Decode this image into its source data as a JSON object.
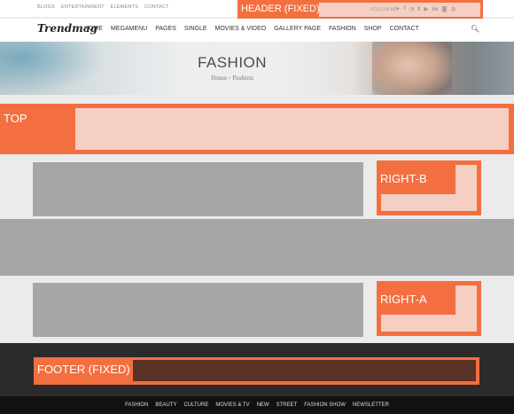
{
  "topbar": {
    "links": [
      "BLOGS",
      "ENTERTAINMENT",
      "ELEMENTS",
      "CONTACT"
    ],
    "header_label": "HEADER (FIXED)",
    "follow_label": "FOLLOW ME:",
    "social_icons": [
      "twitter-icon",
      "facebook-icon",
      "rss-icon",
      "tumblr-icon",
      "youtube-icon",
      "linkedin-icon",
      "instagram-icon",
      "dribbble-icon"
    ]
  },
  "nav": {
    "logo": "Trendmag",
    "items": [
      "HOME",
      "MEGAMENU",
      "PAGES",
      "SINGLE",
      "MOVIES & VIDEO",
      "GALLERY PAGE",
      "FASHION",
      "SHOP",
      "CONTACT"
    ],
    "search_icon": "search-icon"
  },
  "banner": {
    "title": "FASHION",
    "breadcrumb": "Home  ›  Fashion"
  },
  "sections": {
    "top_label": "TOP",
    "right_b_label": "RIGHT-B",
    "right_a_label": "RIGHT-A",
    "footer_label": "FOOTER (FIXED)"
  },
  "bottom": {
    "links": [
      "FASHION",
      "BEAUTY",
      "CULTURE",
      "MOVIES & TV",
      "NEW",
      "STREET",
      "FASHION SHOW",
      "NEWSLETTER"
    ]
  },
  "colors": {
    "accent": "#f36f40",
    "placeholder_pink": "#f4cfc2",
    "placeholder_gray": "#a6a6a6",
    "footer_dark": "#2b2b2b"
  }
}
